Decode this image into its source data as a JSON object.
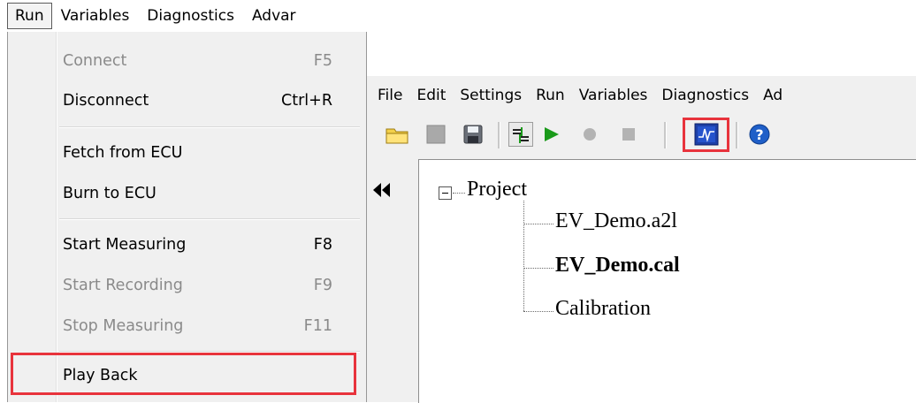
{
  "left_menubar": {
    "items": [
      "Run",
      "Variables",
      "Diagnostics",
      "Advar"
    ],
    "active": "Run"
  },
  "run_menu": {
    "items": [
      {
        "label": "Connect",
        "shortcut": "F5",
        "enabled": false
      },
      {
        "label": "Disconnect",
        "shortcut": "Ctrl+R",
        "enabled": true
      },
      {
        "label": "Fetch from ECU",
        "shortcut": "",
        "enabled": true
      },
      {
        "label": "Burn to ECU",
        "shortcut": "",
        "enabled": true
      },
      {
        "label": "Start Measuring",
        "shortcut": "F8",
        "enabled": true
      },
      {
        "label": "Start Recording",
        "shortcut": "F9",
        "enabled": false
      },
      {
        "label": "Stop Measuring",
        "shortcut": "F11",
        "enabled": false
      },
      {
        "label": "Play Back",
        "shortcut": "",
        "enabled": true,
        "highlighted": true
      }
    ]
  },
  "right_menubar": {
    "items": [
      "File",
      "Edit",
      "Settings",
      "Run",
      "Variables",
      "Diagnostics",
      "Ad"
    ]
  },
  "toolbar": {
    "buttons": [
      "open-folder-icon",
      "stop-gray-icon",
      "save-disk-icon",
      "connect-plug-icon",
      "play-icon",
      "record-icon",
      "stop-icon",
      "graph-viewer-icon",
      "help-icon"
    ],
    "highlighted": "graph-viewer-icon"
  },
  "tree": {
    "root": "Project",
    "children": [
      {
        "label": "EV_Demo.a2l",
        "bold": false
      },
      {
        "label": "EV_Demo.cal",
        "bold": true
      },
      {
        "label": "Calibration",
        "bold": false
      }
    ]
  },
  "colors": {
    "highlight": "#e8333c",
    "menu_bg": "#f0f0f0",
    "disabled_text": "#8a8a8a",
    "play_green": "#1a9a1a",
    "help_blue": "#1f5fc8"
  }
}
